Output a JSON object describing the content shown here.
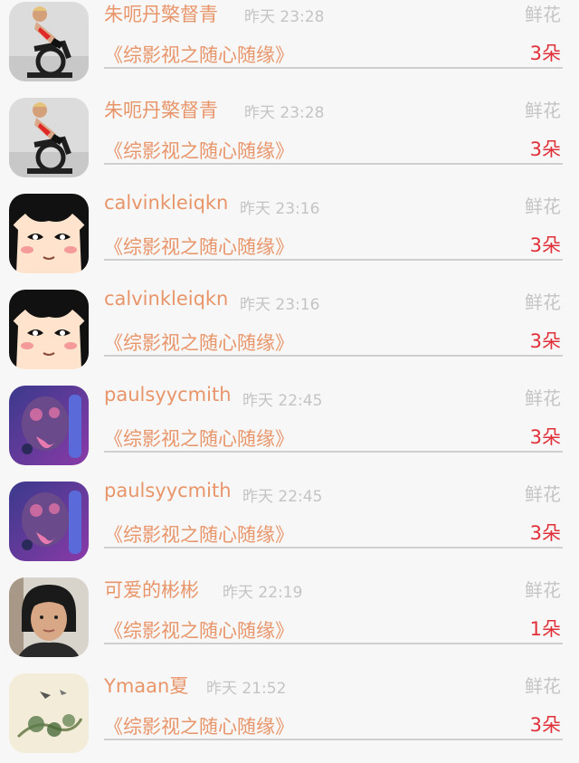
{
  "rows": [
    {
      "name": "朱呃丹檠督青",
      "time": "昨天 23:28",
      "gift": "鲜花",
      "work": "《综影视之随心随缘》",
      "count": "3朵",
      "avatar": "cyclist-photo"
    },
    {
      "name": "朱呃丹檠督青",
      "time": "昨天 23:28",
      "gift": "鲜花",
      "work": "《综影视之随心随缘》",
      "count": "3朵",
      "avatar": "cyclist-photo"
    },
    {
      "name": "calvinkleiqkn",
      "time": "昨天 23:16",
      "gift": "鲜花",
      "work": "《综影视之随心随缘》",
      "count": "3朵",
      "avatar": "anime-girl"
    },
    {
      "name": "calvinkleiqkn",
      "time": "昨天 23:16",
      "gift": "鲜花",
      "work": "《综影视之随心随缘》",
      "count": "3朵",
      "avatar": "anime-girl"
    },
    {
      "name": "paulsyycmith",
      "time": "昨天 22:45",
      "gift": "鲜花",
      "work": "《综影视之随心随缘》",
      "count": "3朵",
      "avatar": "game-monster"
    },
    {
      "name": "paulsyycmith",
      "time": "昨天 22:45",
      "gift": "鲜花",
      "work": "《综影视之随心随缘》",
      "count": "3朵",
      "avatar": "game-monster"
    },
    {
      "name": "可爱的彬彬",
      "time": "昨天 22:19",
      "gift": "鲜花",
      "work": "《综影视之随心随缘》",
      "count": "1朵",
      "avatar": "person-photo"
    },
    {
      "name": "Ymaan夏",
      "time": "昨天 21:52",
      "gift": "鲜花",
      "work": "《综影视之随心随缘》",
      "count": "3朵",
      "avatar": "ink-painting"
    }
  ],
  "colors": {
    "name": "#e8956a",
    "count": "#e0303a",
    "muted": "#c4c4c4",
    "separator": "#cfcfcf"
  }
}
